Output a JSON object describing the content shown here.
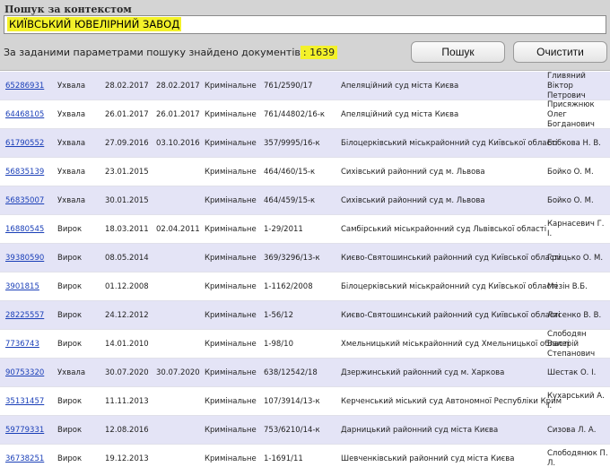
{
  "search": {
    "label": "Пошук за контекстом",
    "query": "КИЇВСЬКИЙ ЮВЕЛІРНИЙ ЗАВОД"
  },
  "summary": {
    "text": "За заданими параметрами пошуку знайдено документів",
    "count": ": 1639"
  },
  "buttons": {
    "search_label": "Пошук",
    "clear_label": "Очистити"
  },
  "colors": {
    "highlight": "#f3f12a",
    "link": "#1a3fb8",
    "row_tint": "#e4e4f6",
    "panel": "#d4d4d4"
  },
  "rows": [
    {
      "id": "65286931",
      "type": "Ухвала",
      "reg_date": "28.02.2017",
      "pub_date": "28.02.2017",
      "form": "Кримінальне",
      "case_num": "761/2590/17",
      "court": "Апеляційний суд міста Києва",
      "judge": "Гливяний Віктор Петрович"
    },
    {
      "id": "64468105",
      "type": "Ухвала",
      "reg_date": "26.01.2017",
      "pub_date": "26.01.2017",
      "form": "Кримінальне",
      "case_num": "761/44802/16-к",
      "court": "Апеляційний суд міста Києва",
      "judge": "Присяжнюк Олег Богданович"
    },
    {
      "id": "61790552",
      "type": "Ухвала",
      "reg_date": "27.09.2016",
      "pub_date": "03.10.2016",
      "form": "Кримінальне",
      "case_num": "357/9995/16-к",
      "court": "Білоцерківський міськрайонний суд Київської області",
      "judge": "Бобкова Н. В."
    },
    {
      "id": "56835139",
      "type": "Ухвала",
      "reg_date": "23.01.2015",
      "pub_date": "",
      "form": "Кримінальне",
      "case_num": "464/460/15-к",
      "court": "Сихівський районний суд м. Львова",
      "judge": "Бойко О. М."
    },
    {
      "id": "56835007",
      "type": "Ухвала",
      "reg_date": "30.01.2015",
      "pub_date": "",
      "form": "Кримінальне",
      "case_num": "464/459/15-к",
      "court": "Сихівський районний суд м. Львова",
      "judge": "Бойко О. М."
    },
    {
      "id": "16880545",
      "type": "Вирок",
      "reg_date": "18.03.2011",
      "pub_date": "02.04.2011",
      "form": "Кримінальне",
      "case_num": "1-29/2011",
      "court": "Самбірський міськрайонний суд Львівської області",
      "judge": "Карнасевич Г. І."
    },
    {
      "id": "39380590",
      "type": "Вирок",
      "reg_date": "08.05.2014",
      "pub_date": "",
      "form": "Кримінальне",
      "case_num": "369/3296/13-к",
      "court": "Києво-Святошинський районний суд Київської області",
      "judge": "Грицько О. М."
    },
    {
      "id": "3901815",
      "type": "Вирок",
      "reg_date": "01.12.2008",
      "pub_date": "",
      "form": "Кримінальне",
      "case_num": "1-1162/2008",
      "court": "Білоцерківський міськрайонний суд Київської області",
      "judge": "Мезін В.Б."
    },
    {
      "id": "28225557",
      "type": "Вирок",
      "reg_date": "24.12.2012",
      "pub_date": "",
      "form": "Кримінальне",
      "case_num": "1-56/12",
      "court": "Києво-Святошинський районний суд Київської області",
      "judge": "Лисенко В. В."
    },
    {
      "id": "7736743",
      "type": "Вирок",
      "reg_date": "14.01.2010",
      "pub_date": "",
      "form": "Кримінальне",
      "case_num": "1-98/10",
      "court": "Хмельницький міськрайонний суд Хмельницької області",
      "judge": "Слободян Валерій Степанович"
    },
    {
      "id": "90753320",
      "type": "Ухвала",
      "reg_date": "30.07.2020",
      "pub_date": "30.07.2020",
      "form": "Кримінальне",
      "case_num": "638/12542/18",
      "court": "Дзержинський районний суд м. Харкова",
      "judge": "Шестак О. І."
    },
    {
      "id": "35131457",
      "type": "Вирок",
      "reg_date": "11.11.2013",
      "pub_date": "",
      "form": "Кримінальне",
      "case_num": "107/3914/13-к",
      "court": "Керченський міський суд Автономної Республіки Крим",
      "judge": "Кухарський А. І."
    },
    {
      "id": "59779331",
      "type": "Вирок",
      "reg_date": "12.08.2016",
      "pub_date": "",
      "form": "Кримінальне",
      "case_num": "753/6210/14-к",
      "court": "Дарницький районний суд міста Києва",
      "judge": "Сизова Л. А."
    },
    {
      "id": "36738251",
      "type": "Вирок",
      "reg_date": "19.12.2013",
      "pub_date": "",
      "form": "Кримінальне",
      "case_num": "1-1691/11",
      "court": "Шевченківський районний суд міста Києва",
      "judge": "Слободянюк П. Л."
    }
  ]
}
